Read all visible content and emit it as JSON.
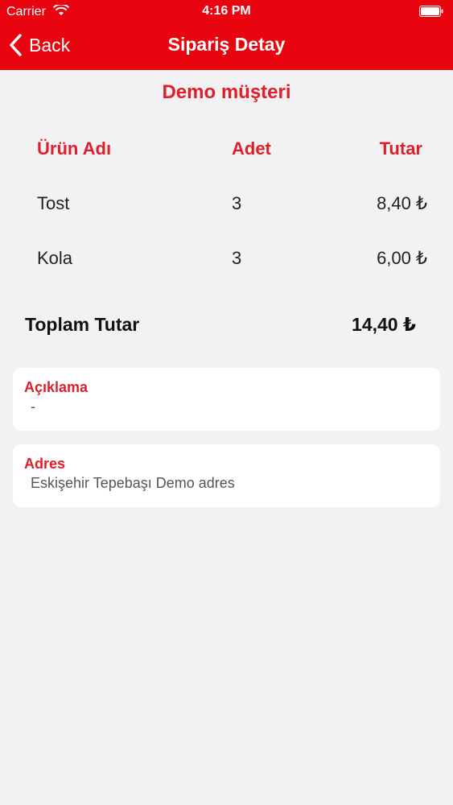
{
  "status_bar": {
    "carrier": "Carrier",
    "time": "4:16 PM"
  },
  "nav": {
    "back_label": "Back",
    "title": "Sipariş Detay"
  },
  "customer_name": "Demo müşteri",
  "table": {
    "headers": [
      "Ürün Adı",
      "Adet",
      "Tutar"
    ],
    "rows": [
      {
        "name": "Tost",
        "qty": "3",
        "amount": "8,40 ₺"
      },
      {
        "name": "Kola",
        "qty": "3",
        "amount": "6,00 ₺"
      }
    ]
  },
  "total": {
    "label": "Toplam Tutar",
    "value": "14,40 ₺"
  },
  "cards": {
    "description": {
      "title": "Açıklama",
      "value": "-"
    },
    "address": {
      "title": "Adres",
      "value": "Eskişehir Tepebaşı Demo adres"
    }
  },
  "colors": {
    "nav_bar": "#e8050f",
    "accent": "#e01e2a",
    "background": "#f2f2f4"
  }
}
